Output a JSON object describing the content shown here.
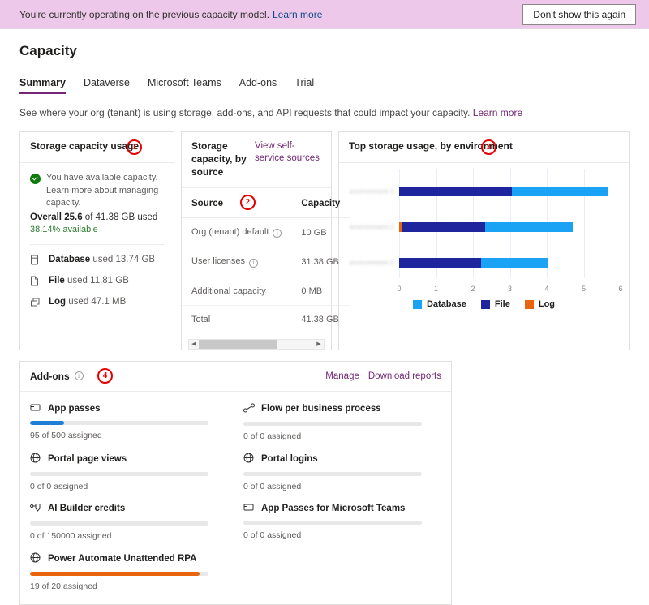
{
  "banner": {
    "text": "You're currently operating on the previous capacity model.",
    "link": "Learn more",
    "dismiss_label": "Don't show this again",
    "bg_color": "#edc8ea"
  },
  "header": {
    "title": "Capacity",
    "subtitle": "See where your org (tenant) is using storage, add-ons, and API requests that could impact your capacity.",
    "subtitle_link": "Learn more"
  },
  "tabs": [
    {
      "label": "Summary",
      "active": true
    },
    {
      "label": "Dataverse",
      "active": false
    },
    {
      "label": "Microsoft Teams",
      "active": false
    },
    {
      "label": "Add-ons",
      "active": false
    },
    {
      "label": "Trial",
      "active": false
    }
  ],
  "storage_usage_card": {
    "title": "Storage capacity usage",
    "annotation": "1",
    "status_message": "You have available capacity. Learn more about managing capacity.",
    "status_link": "Learn more about managing capacity.",
    "overall_label": "Overall",
    "overall_value": "25.6",
    "overall_rest": "of 41.38 GB used",
    "available_text": "38.14% available",
    "available_color": "#2e7d32",
    "items": [
      {
        "icon": "database-icon",
        "name": "Database",
        "rest": "used 13.74 GB"
      },
      {
        "icon": "file-icon",
        "name": "File",
        "rest": "used 11.81 GB"
      },
      {
        "icon": "log-icon",
        "name": "Log",
        "rest": "used 47.1 MB"
      }
    ]
  },
  "source_card": {
    "title": "Storage capacity, by source",
    "link": "View self-service sources",
    "annotation": "2",
    "columns": [
      "Source",
      "Capacity"
    ],
    "rows": [
      {
        "source": "Org (tenant) default",
        "has_info": true,
        "capacity": "10 GB"
      },
      {
        "source": "User licenses",
        "has_info": true,
        "capacity": "31.38 GB"
      },
      {
        "source": "Additional capacity",
        "has_info": false,
        "capacity": "0 MB"
      },
      {
        "source": "Total",
        "has_info": false,
        "capacity": "41.38 GB"
      }
    ]
  },
  "chart_card": {
    "title": "Top storage usage, by environment",
    "annotation": "3"
  },
  "chart_data": {
    "type": "bar",
    "orientation": "horizontal",
    "stacked": true,
    "title": "Top storage usage, by environment",
    "xlabel": "",
    "ylabel": "",
    "xlim": [
      0,
      6
    ],
    "xticks": [
      0,
      1,
      2,
      3,
      4,
      5,
      6
    ],
    "grid": true,
    "legend_position": "bottom",
    "categories": [
      "environment-1",
      "environment-2",
      "environment-3"
    ],
    "categories_redacted": true,
    "series": [
      {
        "name": "Log",
        "color": "#e8650d",
        "values": [
          0.0,
          0.06,
          0.0
        ]
      },
      {
        "name": "File",
        "color": "#1f259c",
        "values": [
          3.06,
          2.28,
          2.21
        ]
      },
      {
        "name": "Database",
        "color": "#1aa3f5",
        "values": [
          2.58,
          2.36,
          1.83
        ]
      }
    ],
    "totals": [
      5.64,
      4.7,
      4.04
    ],
    "legend": [
      {
        "label": "Database",
        "color": "#1aa3f5"
      },
      {
        "label": "File",
        "color": "#1f259c"
      },
      {
        "label": "Log",
        "color": "#e8650d"
      }
    ]
  },
  "addons_card": {
    "title": "Add-ons",
    "annotation": "4",
    "manage_label": "Manage",
    "download_label": "Download reports",
    "items": [
      {
        "icon": "app-passes-icon",
        "name": "App passes",
        "assigned": 95,
        "total": 500,
        "sub": "95 of 500 assigned",
        "percent": 19,
        "fill_color": "#1f7fd4"
      },
      {
        "icon": "flow-icon",
        "name": "Flow per business process",
        "assigned": 0,
        "total": 0,
        "sub": "0 of 0 assigned",
        "percent": 0,
        "fill_color": "#1f7fd4"
      },
      {
        "icon": "globe-icon",
        "name": "Portal page views",
        "assigned": 0,
        "total": 0,
        "sub": "0 of 0 assigned",
        "percent": 0,
        "fill_color": "#1f7fd4"
      },
      {
        "icon": "globe-icon",
        "name": "Portal logins",
        "assigned": 0,
        "total": 0,
        "sub": "0 of 0 assigned",
        "percent": 0,
        "fill_color": "#1f7fd4"
      },
      {
        "icon": "ai-builder-icon",
        "name": "AI Builder credits",
        "assigned": 0,
        "total": 150000,
        "sub": "0 of 150000 assigned",
        "percent": 0,
        "fill_color": "#1f7fd4"
      },
      {
        "icon": "app-passes-icon",
        "name": "App Passes for Microsoft Teams",
        "assigned": 0,
        "total": 0,
        "sub": "0 of 0 assigned",
        "percent": 0,
        "fill_color": "#1f7fd4"
      },
      {
        "icon": "globe-icon",
        "name": "Power Automate Unattended RPA",
        "assigned": 19,
        "total": 20,
        "sub": "19 of 20 assigned",
        "percent": 95,
        "fill_color": "#e8650d"
      }
    ]
  }
}
